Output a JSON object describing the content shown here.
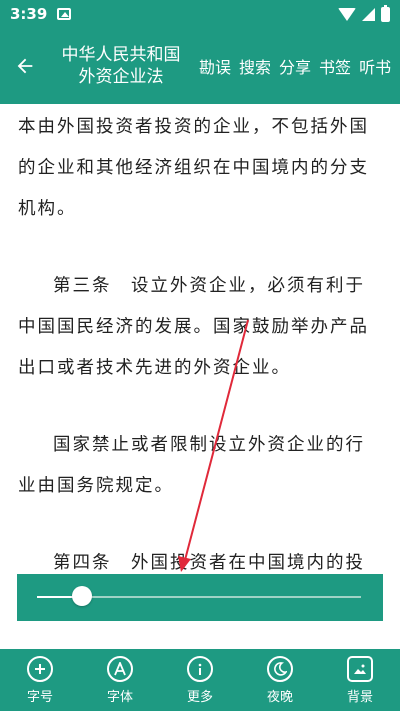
{
  "status_bar": {
    "time": "3:39"
  },
  "app_bar": {
    "title_line1": "中华人民共和国",
    "title_line2": "外资企业法",
    "actions": [
      "勘误",
      "搜索",
      "分享",
      "书签",
      "听书"
    ]
  },
  "content": {
    "paragraphs": [
      "本由外国投资者投资的企业，不包括外国的企业和其他经济组织在中国境内的分支机构。",
      "第三条　设立外资企业，必须有利于中国国民经济的发展。国家鼓励举办产品出口或者技术先进的外资企业。",
      "国家禁止或者限制设立外资企业的行业由国务院规定。",
      "第四条　外国投资者在中国境内的投资、获得的利润和其他合法权益，受中国"
    ]
  },
  "slider": {
    "value": 0.14
  },
  "bottom_toolbar": {
    "items": [
      {
        "label": "字号",
        "icon": "zoom-in-icon"
      },
      {
        "label": "字体",
        "icon": "font-icon"
      },
      {
        "label": "更多",
        "icon": "info-icon"
      },
      {
        "label": "夜晚",
        "icon": "night-mode-icon"
      },
      {
        "label": "背景",
        "icon": "background-image-icon"
      }
    ]
  },
  "colors": {
    "primary": "#1e9a82",
    "arrow": "#e0293a"
  }
}
